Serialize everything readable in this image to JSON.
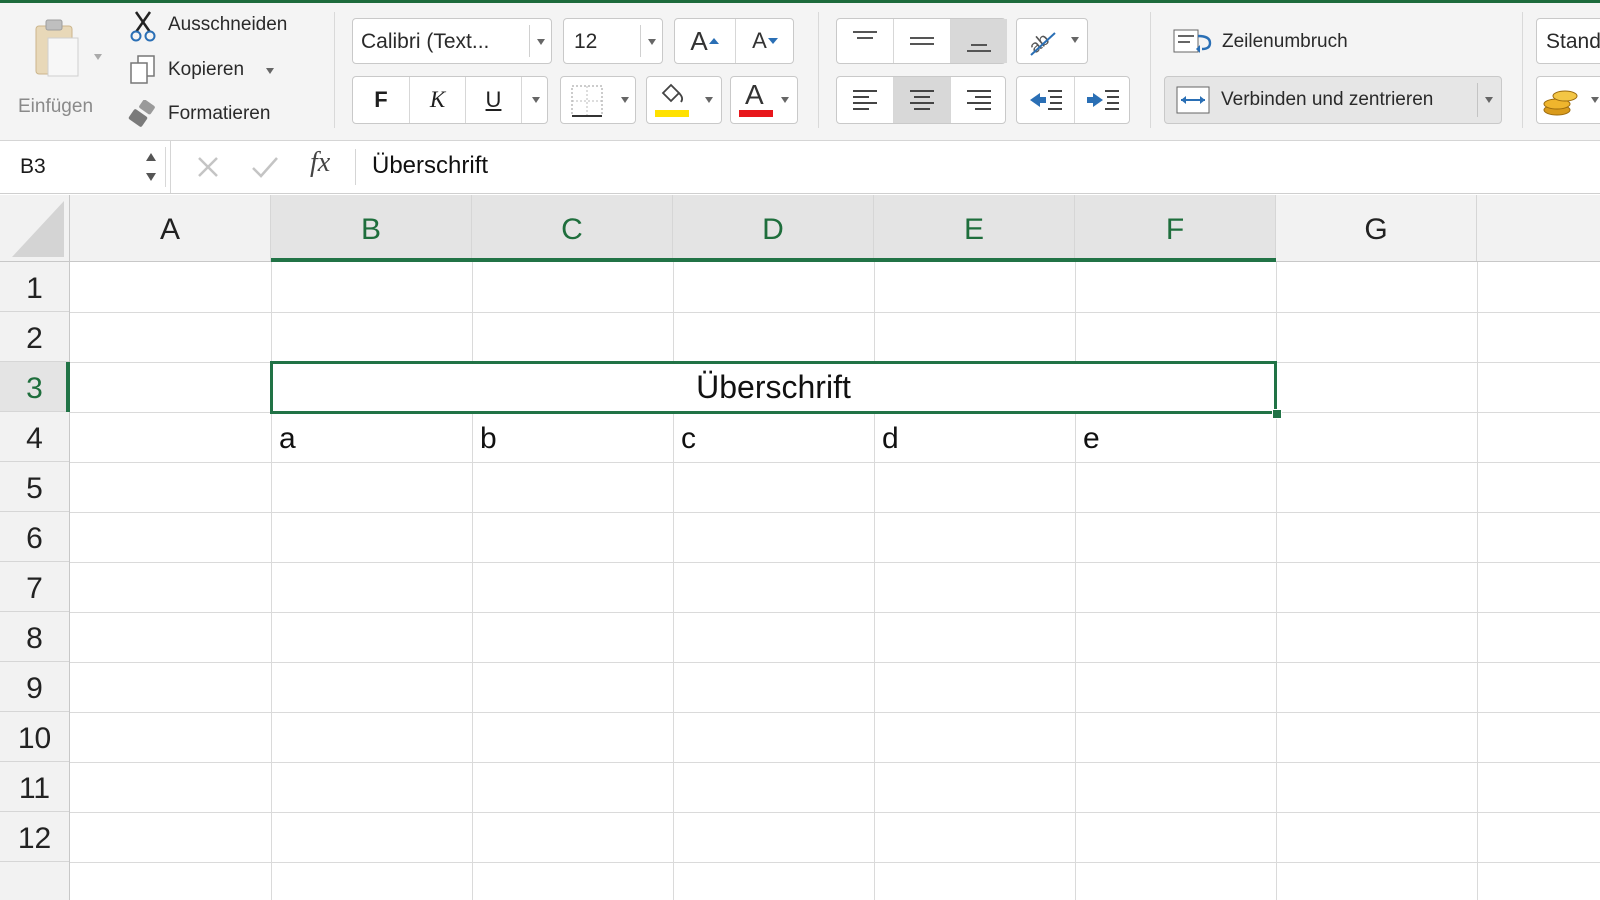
{
  "ribbon": {
    "clipboard": {
      "paste_label": "Einfügen",
      "cut_label": "Ausschneiden",
      "copy_label": "Kopieren",
      "format_label": "Formatieren"
    },
    "font": {
      "family": "Calibri (Text...",
      "size": "12",
      "bold_label": "F",
      "italic_label": "K",
      "underline_label": "U",
      "grow_label": "A",
      "shrink_label": "A",
      "fill_color": "#ffe100",
      "font_color": "#e8161b"
    },
    "alignment": {
      "wrap_label": "Zeilenumbruch",
      "merge_label": "Verbinden und zentrieren"
    },
    "number": {
      "format_value": "Stand"
    }
  },
  "formula_bar": {
    "name_box": "B3",
    "fx_label": "fx",
    "content": "Überschrift"
  },
  "sheet": {
    "columns": [
      "A",
      "B",
      "C",
      "D",
      "E",
      "F",
      "G"
    ],
    "selected_columns": [
      "B",
      "C",
      "D",
      "E",
      "F"
    ],
    "rows": [
      "1",
      "2",
      "3",
      "4",
      "5",
      "6",
      "7",
      "8",
      "9",
      "10",
      "11",
      "12"
    ],
    "selected_row": "3",
    "merged": {
      "range": "B3:F3",
      "value": "Überschrift"
    },
    "cells": {
      "B4": "a",
      "C4": "b",
      "D4": "c",
      "E4": "d",
      "F4": "e"
    },
    "accent_color": "#217346"
  }
}
